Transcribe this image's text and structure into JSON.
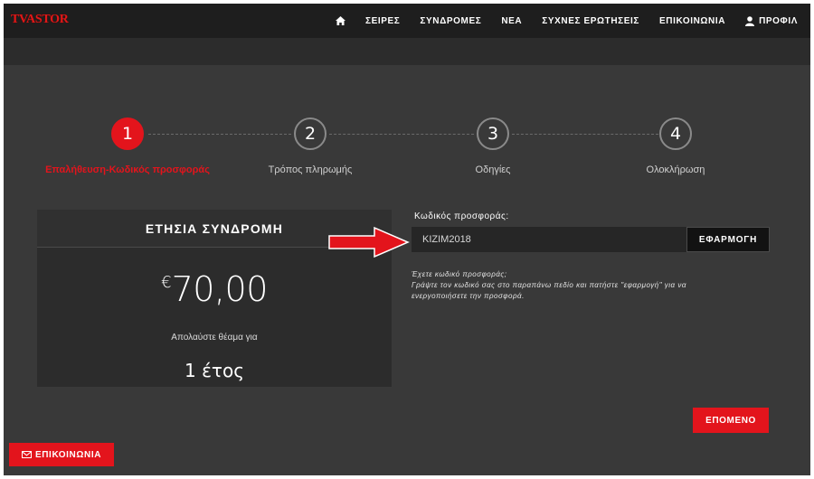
{
  "app": {
    "logo": "TVASTOR"
  },
  "nav": {
    "home_icon": "home-icon",
    "items": [
      "ΣΕΙΡΕΣ",
      "ΣΥΝΔΡΟΜΕΣ",
      "ΝΕΑ",
      "ΣΥΧΝΕΣ ΕΡΩΤΗΣΕΙΣ",
      "ΕΠΙΚΟΙΝΩΝΙΑ"
    ],
    "profile_icon": "user-icon",
    "profile_label": "ΠΡΟΦΙΛ"
  },
  "steps": [
    {
      "number": "1",
      "label": "Επαλήθευση-Κωδικός προσφοράς",
      "active": true
    },
    {
      "number": "2",
      "label": "Τρόπος πληρωμής",
      "active": false
    },
    {
      "number": "3",
      "label": "Οδηγίες",
      "active": false
    },
    {
      "number": "4",
      "label": "Ολοκλήρωση",
      "active": false
    }
  ],
  "plan": {
    "title": "ΕΤΗΣΙΑ ΣΥΝΔΡΟΜΗ",
    "currency": "€",
    "price": "70,00",
    "enjoy_text": "Απολαύστε θέαμα για",
    "period": "1 έτος"
  },
  "coupon": {
    "label": "Κωδικός προσφοράς:",
    "value": "KIZIM2018",
    "apply_label": "ΕΦΑΡΜΟΓΗ",
    "hint_line1": "Έχετε κωδικό προσφοράς;",
    "hint_line2": "Γράψτε τον κωδικό σας στο παραπάνω πεδίο και πατήστε \"εφαρμογή\" για να",
    "hint_line3": "ενεργοποιήσετε την προσφορά."
  },
  "actions": {
    "next_label": "ΕΠΟΜΕΝΟ",
    "contact_label": "ΕΠΙΚΟΙΝΩΝΙΑ",
    "contact_icon": "envelope-icon"
  },
  "colors": {
    "accent": "#e3141c",
    "background": "#393939",
    "nav": "#1e1e1e"
  }
}
